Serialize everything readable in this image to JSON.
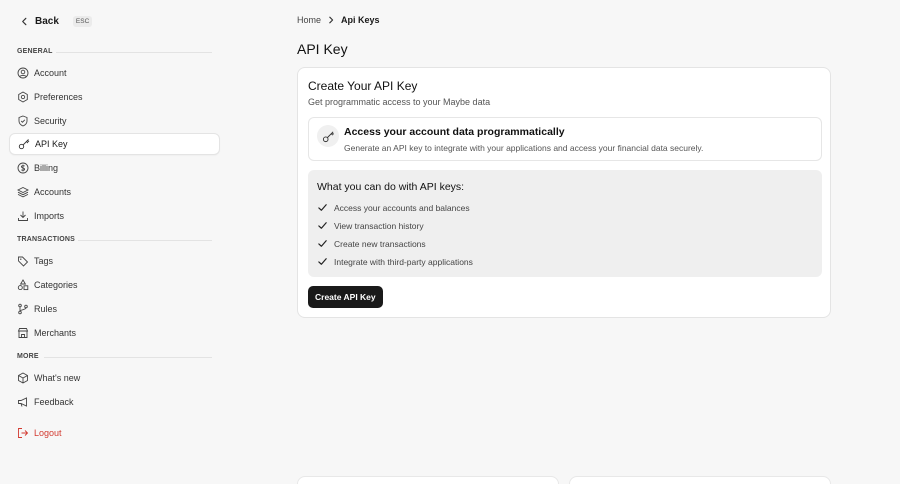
{
  "sidebar": {
    "back_label": "Back",
    "esc_label": "ESC",
    "sections": {
      "general": "GENERAL",
      "transactions": "TRANSACTIONS",
      "more": "MORE"
    },
    "items": {
      "account": "Account",
      "preferences": "Preferences",
      "security": "Security",
      "api_key": "API Key",
      "billing": "Billing",
      "accounts": "Accounts",
      "imports": "Imports",
      "tags": "Tags",
      "categories": "Categories",
      "rules": "Rules",
      "merchants": "Merchants",
      "whats_new": "What's new",
      "feedback": "Feedback",
      "logout": "Logout"
    },
    "active_item": "api_key"
  },
  "breadcrumb": {
    "home": "Home",
    "current": "Api Keys"
  },
  "page": {
    "title": "API Key"
  },
  "card": {
    "title": "Create Your API Key",
    "subtitle": "Get programmatic access to your Maybe data",
    "info": {
      "icon": "key-icon",
      "title": "Access your account data programmatically",
      "description": "Generate an API key to integrate with your applications and access your financial data securely."
    },
    "features": {
      "title": "What you can do with API keys:",
      "items": [
        "Access your accounts and balances",
        "View transaction history",
        "Create new transactions",
        "Integrate with third-party applications"
      ]
    },
    "create_button": "Create API Key"
  },
  "colors": {
    "background": "#f7f7f7",
    "primary_button": "#1a1a1a",
    "logout": "#d23a30",
    "feature_panel": "#efefef"
  }
}
